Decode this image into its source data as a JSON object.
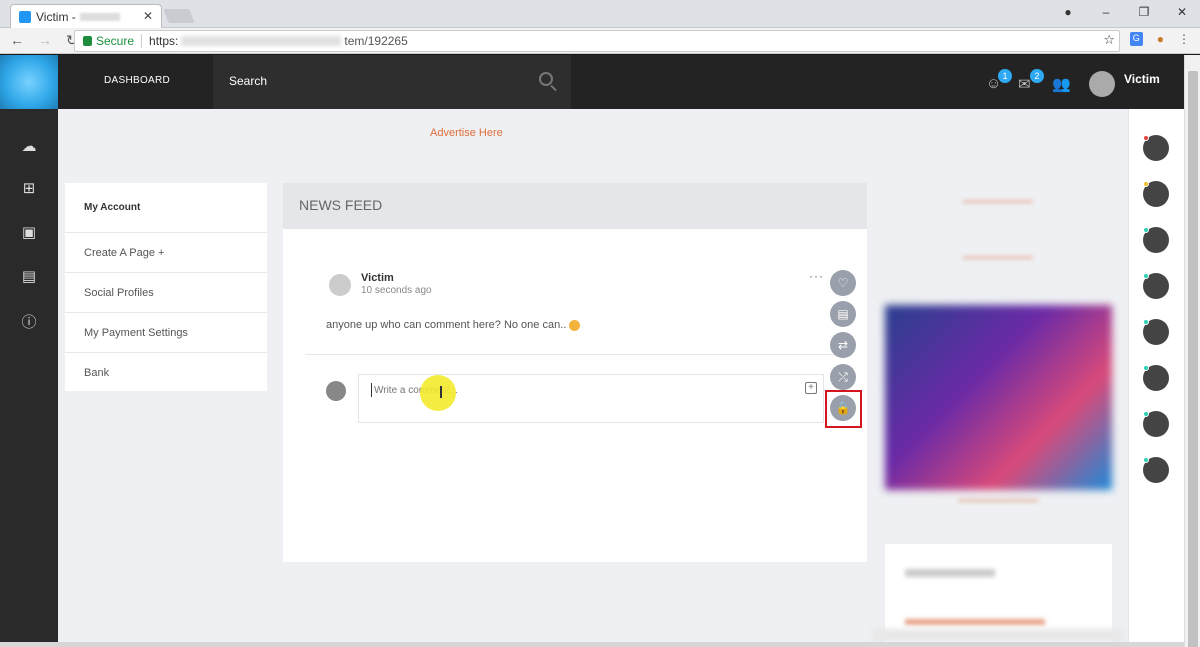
{
  "browser": {
    "tab_title": "Victim -",
    "tab_close": "✕",
    "win_controls": [
      "–",
      "❐",
      "✕"
    ],
    "secure_label": "Secure",
    "url_proto": "https:",
    "url_path": "tem/192265",
    "star": "☆",
    "menu_icon": "⋮"
  },
  "header": {
    "nav_dashboard": "DASHBOARD",
    "search_placeholder": "Search",
    "notif_badge": "1",
    "msg_badge": "2",
    "user_name": "Victim"
  },
  "main": {
    "advertise": "Advertise Here",
    "account_menu": [
      "My Account",
      "Create A Page +",
      "Social Profiles",
      "My Payment Settings",
      "Bank"
    ],
    "feed_title": "NEWS FEED",
    "post": {
      "author": "Victim",
      "time": "10 seconds ago",
      "more": "···",
      "text": "anyone up who can comment here? No one can.."
    },
    "comment_placeholder": "Write a comment...",
    "comment_plus": "+"
  },
  "colors": {
    "accent_blue": "#2ea9f5",
    "advert_orange": "#e06e3a",
    "highlight_red": "#d4171f",
    "chat_online_teal": "#2bd2b5"
  }
}
